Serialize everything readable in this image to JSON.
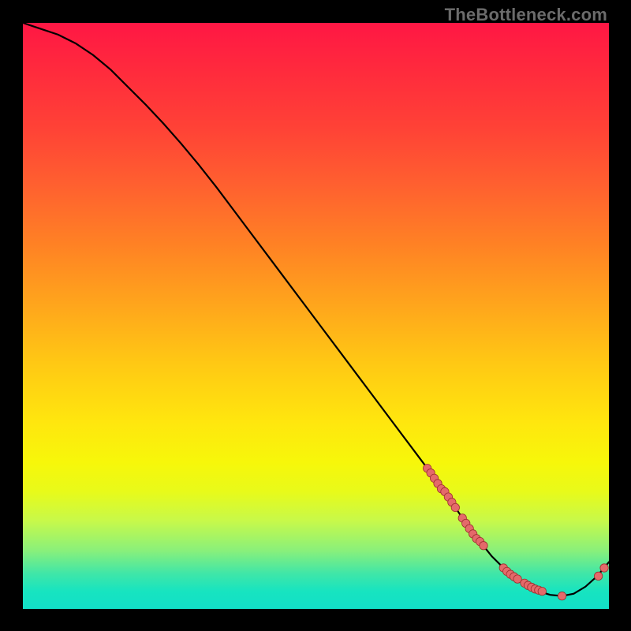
{
  "watermark": {
    "text": "TheBottleneck.com"
  },
  "colors": {
    "curve": "#000000",
    "dot_fill": "#e46a6a",
    "dot_stroke": "#9e2f2f",
    "frame_bg": "#000000"
  },
  "chart_data": {
    "type": "line",
    "title": "",
    "xlabel": "",
    "ylabel": "",
    "xlim": [
      0,
      100
    ],
    "ylim": [
      0,
      100
    ],
    "grid": false,
    "legend": false,
    "series": [
      {
        "name": "curve",
        "x": [
          0,
          3,
          6,
          9,
          12,
          15,
          18,
          21,
          24,
          27,
          30,
          33,
          36,
          39,
          42,
          45,
          48,
          51,
          54,
          57,
          60,
          63,
          66,
          69,
          72,
          74,
          76,
          78,
          80,
          82,
          84,
          86,
          88,
          90,
          92,
          94,
          96,
          98,
          100
        ],
        "y": [
          100,
          99,
          98,
          96.5,
          94.5,
          92,
          89,
          86,
          82.8,
          79.4,
          75.8,
          72,
          68,
          64,
          60,
          56,
          52,
          48,
          44,
          40,
          36,
          32,
          28,
          24,
          20,
          17,
          14,
          11.5,
          9,
          7,
          5.4,
          4,
          3,
          2.4,
          2.2,
          2.6,
          3.8,
          5.6,
          8
        ]
      }
    ],
    "points": [
      {
        "x": 69.0,
        "y": 24.0
      },
      {
        "x": 69.6,
        "y": 23.2
      },
      {
        "x": 70.2,
        "y": 22.3
      },
      {
        "x": 70.8,
        "y": 21.4
      },
      {
        "x": 71.4,
        "y": 20.5
      },
      {
        "x": 72.0,
        "y": 20.0
      },
      {
        "x": 72.6,
        "y": 19.1
      },
      {
        "x": 73.2,
        "y": 18.2
      },
      {
        "x": 73.8,
        "y": 17.3
      },
      {
        "x": 75.0,
        "y": 15.5
      },
      {
        "x": 75.6,
        "y": 14.6
      },
      {
        "x": 76.2,
        "y": 13.7
      },
      {
        "x": 76.8,
        "y": 12.8
      },
      {
        "x": 77.4,
        "y": 12.0
      },
      {
        "x": 78.0,
        "y": 11.5
      },
      {
        "x": 78.6,
        "y": 10.8
      },
      {
        "x": 82.0,
        "y": 7.0
      },
      {
        "x": 82.6,
        "y": 6.4
      },
      {
        "x": 83.2,
        "y": 5.9
      },
      {
        "x": 83.8,
        "y": 5.5
      },
      {
        "x": 84.4,
        "y": 5.1
      },
      {
        "x": 85.6,
        "y": 4.4
      },
      {
        "x": 86.2,
        "y": 4.0
      },
      {
        "x": 86.8,
        "y": 3.7
      },
      {
        "x": 87.4,
        "y": 3.4
      },
      {
        "x": 88.0,
        "y": 3.2
      },
      {
        "x": 88.6,
        "y": 3.0
      },
      {
        "x": 92.0,
        "y": 2.2
      },
      {
        "x": 98.2,
        "y": 5.6
      },
      {
        "x": 99.2,
        "y": 7.0
      }
    ]
  }
}
